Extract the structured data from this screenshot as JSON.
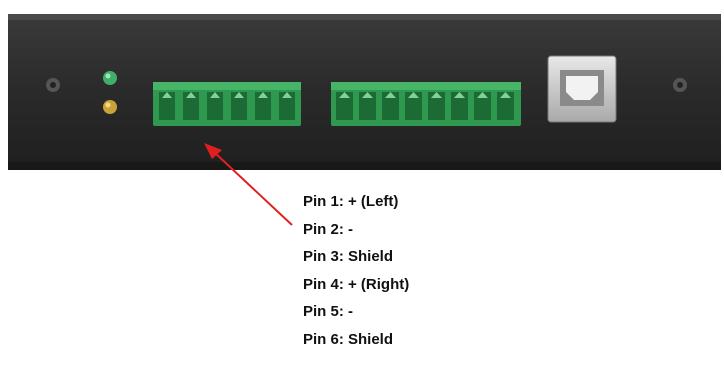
{
  "pin_labels": [
    "Pin 1: + (Left)",
    "Pin 2: -",
    "Pin 3: Shield",
    "Pin 4: + (Right)",
    "Pin 5: -",
    "Pin 6: Shield"
  ],
  "colors": {
    "panel": "#2c2c2c",
    "terminal_green": "#2f9a4f",
    "led_green": "#3fae6a",
    "led_amber": "#c9a23a",
    "arrow": "#e02020"
  },
  "icons": [
    "usb-b-port-icon",
    "screw-icon",
    "led-icon",
    "terminal-block-icon",
    "arrow-icon"
  ]
}
